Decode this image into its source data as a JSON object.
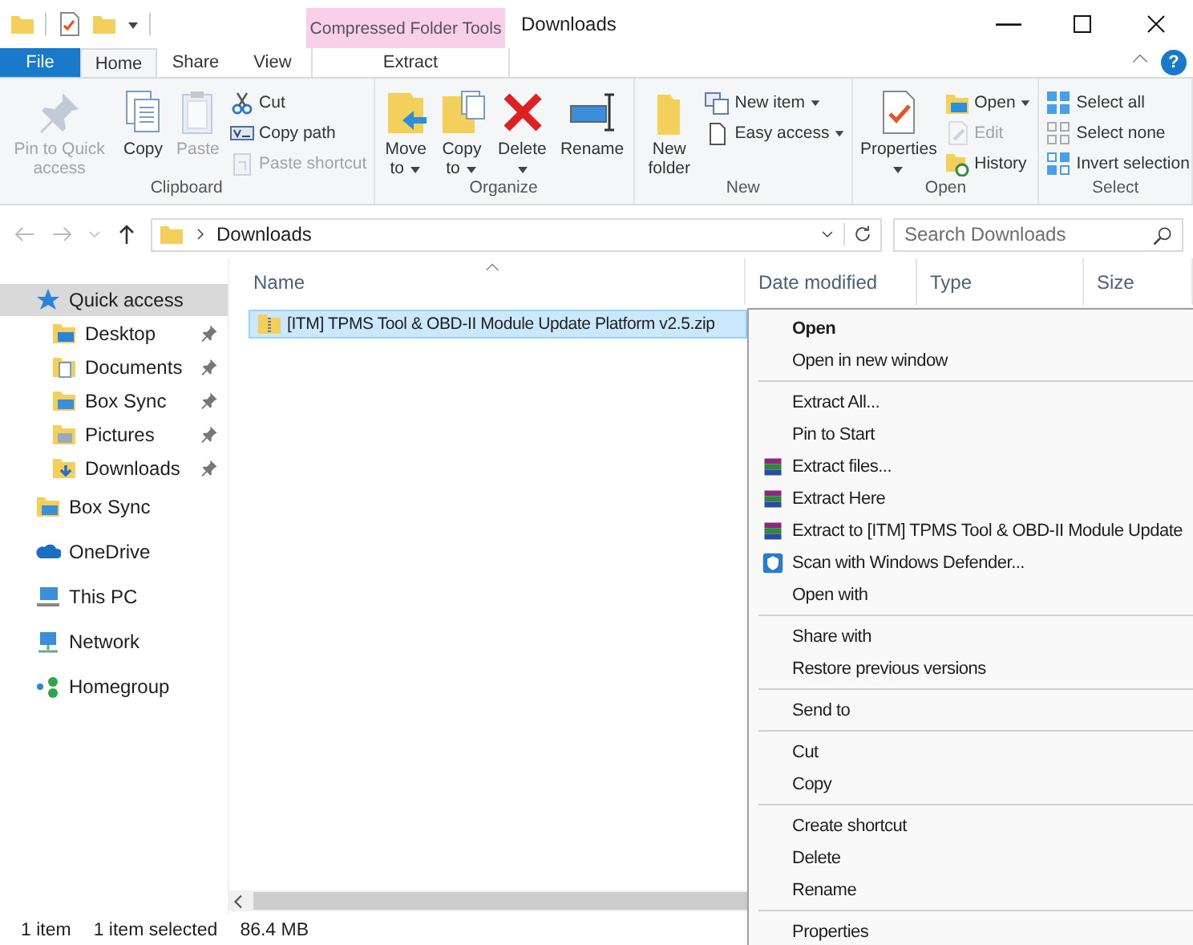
{
  "window": {
    "title": "Downloads",
    "contextual_tab_group": "Compressed Folder Tools"
  },
  "ribbon_tabs": [
    {
      "label": "File",
      "kind": "file",
      "selected": false
    },
    {
      "label": "Home",
      "kind": "tab",
      "selected": true
    },
    {
      "label": "Share",
      "kind": "tab",
      "selected": false
    },
    {
      "label": "View",
      "kind": "tab",
      "selected": false
    },
    {
      "label": "Extract",
      "kind": "contextual",
      "selected": false
    }
  ],
  "help_button": "?",
  "ribbon_groups": [
    {
      "label": "Clipboard",
      "items": [
        {
          "kind": "large",
          "label": "Pin to Quick access",
          "disabled": true,
          "dropdown": false
        },
        {
          "kind": "large",
          "label": "Copy",
          "disabled": false,
          "dropdown": false
        },
        {
          "kind": "large",
          "label": "Paste",
          "disabled": true,
          "dropdown": false
        },
        {
          "kind": "stack",
          "items": [
            {
              "label": "Cut",
              "disabled": false,
              "dropdown": false
            },
            {
              "label": "Copy path",
              "disabled": false,
              "dropdown": false
            },
            {
              "label": "Paste shortcut",
              "disabled": true,
              "dropdown": false
            }
          ]
        }
      ]
    },
    {
      "label": "Organize",
      "items": [
        {
          "kind": "large",
          "label": "Move to",
          "disabled": false,
          "dropdown": true
        },
        {
          "kind": "large",
          "label": "Copy to",
          "disabled": false,
          "dropdown": true
        },
        {
          "kind": "large",
          "label": "Delete",
          "disabled": false,
          "dropdown": true
        },
        {
          "kind": "large",
          "label": "Rename",
          "disabled": false,
          "dropdown": false
        }
      ]
    },
    {
      "label": "New",
      "items": [
        {
          "kind": "large",
          "label": "New folder",
          "disabled": false,
          "dropdown": false
        },
        {
          "kind": "stack",
          "items": [
            {
              "label": "New item",
              "disabled": false,
              "dropdown": true
            },
            {
              "label": "Easy access",
              "disabled": false,
              "dropdown": true
            }
          ]
        }
      ]
    },
    {
      "label": "Open",
      "items": [
        {
          "kind": "large",
          "label": "Properties",
          "disabled": false,
          "dropdown": true
        },
        {
          "kind": "stack",
          "items": [
            {
              "label": "Open",
              "disabled": false,
              "dropdown": true
            },
            {
              "label": "Edit",
              "disabled": true,
              "dropdown": false
            },
            {
              "label": "History",
              "disabled": false,
              "dropdown": false
            }
          ]
        }
      ]
    },
    {
      "label": "Select",
      "items": [
        {
          "kind": "stack",
          "items": [
            {
              "label": "Select all",
              "disabled": false,
              "dropdown": false
            },
            {
              "label": "Select none",
              "disabled": false,
              "dropdown": false
            },
            {
              "label": "Invert selection",
              "disabled": false,
              "dropdown": false
            }
          ]
        }
      ]
    }
  ],
  "address_bar": {
    "path": "Downloads"
  },
  "search": {
    "placeholder": "Search Downloads"
  },
  "navigation_pane": {
    "items": [
      {
        "label": "Quick access",
        "selected": true,
        "children": [
          {
            "label": "Desktop",
            "pinned": true,
            "selected": false
          },
          {
            "label": "Documents",
            "pinned": true,
            "selected": false
          },
          {
            "label": "Box Sync",
            "pinned": true,
            "selected": false
          },
          {
            "label": "Pictures",
            "pinned": true,
            "selected": false
          },
          {
            "label": "Downloads",
            "pinned": true,
            "selected": false
          }
        ]
      },
      {
        "label": "Box Sync",
        "selected": false
      },
      {
        "label": "OneDrive",
        "selected": false
      },
      {
        "label": "This PC",
        "selected": false
      },
      {
        "label": "Network",
        "selected": false
      },
      {
        "label": "Homegroup",
        "selected": false
      }
    ]
  },
  "file_list": {
    "columns": [
      {
        "label": "Name",
        "sorted": true
      },
      {
        "label": "Date modified",
        "sorted": false
      },
      {
        "label": "Type",
        "sorted": false
      },
      {
        "label": "Size",
        "sorted": false
      }
    ],
    "rows": [
      {
        "name": "[ITM] TPMS Tool & OBD-II Module Update Platform v2.5.zip",
        "selected": true
      }
    ]
  },
  "context_menu": {
    "sections": [
      [
        {
          "label": "Open",
          "bold": true,
          "kind": "plain"
        },
        {
          "label": "Open in new window",
          "bold": false,
          "kind": "plain"
        }
      ],
      [
        {
          "label": "Extract All...",
          "bold": false,
          "kind": "plain"
        },
        {
          "label": "Pin to Start",
          "bold": false,
          "kind": "plain"
        },
        {
          "label": "Extract files...",
          "bold": false,
          "kind": "archive"
        },
        {
          "label": "Extract Here",
          "bold": false,
          "kind": "archive"
        },
        {
          "label": "Extract to [ITM] TPMS Tool & OBD-II Module Update",
          "bold": false,
          "kind": "archive"
        },
        {
          "label": "Scan with Windows Defender...",
          "bold": false,
          "kind": "shield"
        },
        {
          "label": "Open with",
          "bold": false,
          "kind": "plain"
        }
      ],
      [
        {
          "label": "Share with",
          "bold": false,
          "kind": "plain"
        },
        {
          "label": "Restore previous versions",
          "bold": false,
          "kind": "plain"
        }
      ],
      [
        {
          "label": "Send to",
          "bold": false,
          "kind": "plain"
        }
      ],
      [
        {
          "label": "Cut",
          "bold": false,
          "kind": "plain"
        },
        {
          "label": "Copy",
          "bold": false,
          "kind": "plain"
        }
      ],
      [
        {
          "label": "Create shortcut",
          "bold": false,
          "kind": "plain"
        },
        {
          "label": "Delete",
          "bold": false,
          "kind": "plain"
        },
        {
          "label": "Rename",
          "bold": false,
          "kind": "plain"
        }
      ],
      [
        {
          "label": "Properties",
          "bold": false,
          "kind": "plain"
        }
      ]
    ]
  },
  "status_bar": {
    "item_count": "1 item",
    "selection": "1 item selected",
    "size": "86.4 MB"
  }
}
